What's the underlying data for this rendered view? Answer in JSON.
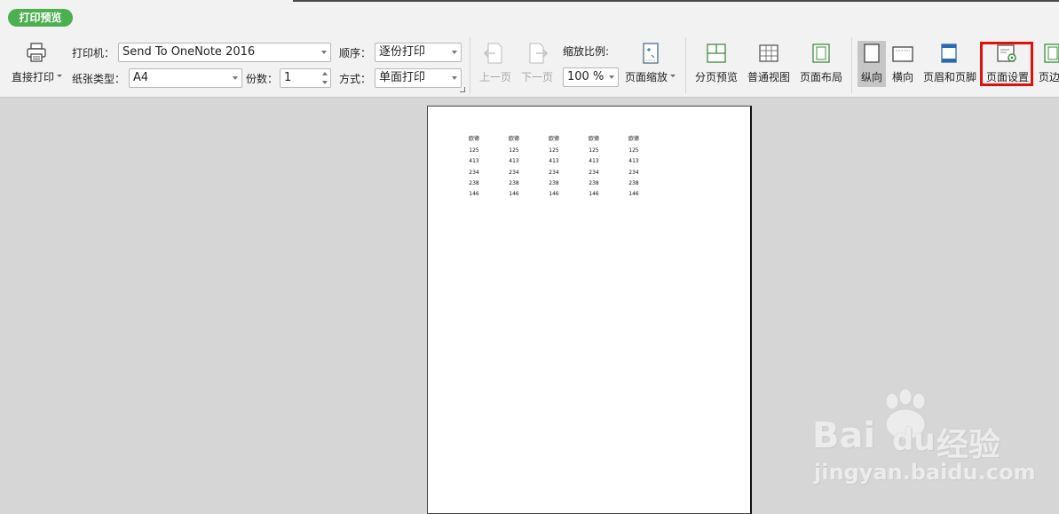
{
  "header": {
    "tab_label": "打印预览"
  },
  "toolbar": {
    "direct_print": "直接打印",
    "printer_label": "打印机：",
    "printer_value": "Send To OneNote 2016",
    "paper_label": "纸张类型：",
    "paper_value": "A4",
    "copies_label": "份数：",
    "copies_value": "1",
    "order_label": "顺序：",
    "order_value": "逐份打印",
    "mode_label": "方式：",
    "mode_value": "单面打印",
    "prev_page": "上一页",
    "next_page": "下一页",
    "zoom_label": "缩放比例:",
    "zoom_value": "100 %",
    "page_zoom": "页面缩放",
    "page_break_preview": "分页预览",
    "normal_view": "普通视图",
    "page_layout": "页面布局",
    "portrait": "纵向",
    "landscape": "横向",
    "header_footer": "页眉和页脚",
    "page_setup": "页面设置",
    "margins_partial": "页边"
  },
  "preview": {
    "columns": [
      {
        "header": "欧德",
        "values": [
          "125",
          "413",
          "234",
          "238",
          "146"
        ]
      },
      {
        "header": "欧德",
        "values": [
          "125",
          "413",
          "234",
          "238",
          "146"
        ]
      },
      {
        "header": "欧德",
        "values": [
          "125",
          "413",
          "234",
          "238",
          "146"
        ]
      },
      {
        "header": "欧德",
        "values": [
          "125",
          "413",
          "234",
          "238",
          "146"
        ]
      },
      {
        "header": "欧德",
        "values": [
          "125",
          "413",
          "234",
          "238",
          "146"
        ]
      }
    ]
  },
  "watermark": {
    "brand": "Bai",
    "brand2": "du",
    "product": "经验",
    "url": "jingyan.baidu.com"
  },
  "colors": {
    "accent_green": "#4caf50",
    "highlight_red": "#e01010"
  }
}
